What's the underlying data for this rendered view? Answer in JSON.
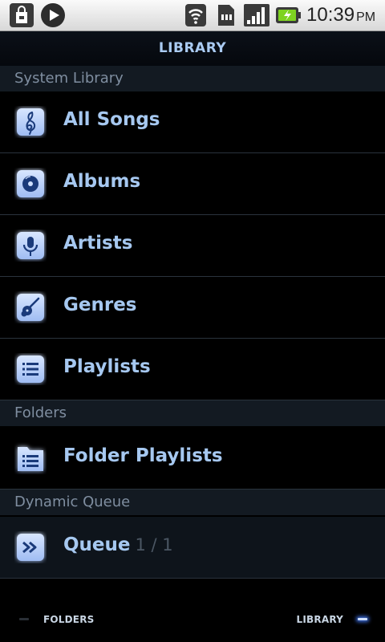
{
  "status_bar": {
    "time": "10:39",
    "ampm": "PM",
    "icons": [
      "shopping-bag-notification-icon",
      "play-notification-icon",
      "wifi-icon",
      "sd-card-icon",
      "cell-signal-icon",
      "battery-charging-icon"
    ]
  },
  "title": "LIBRARY",
  "sections": {
    "system_library": {
      "header": "System Library",
      "items": [
        {
          "label": "All Songs",
          "icon": "treble-clef-icon"
        },
        {
          "label": "Albums",
          "icon": "disc-icon"
        },
        {
          "label": "Artists",
          "icon": "microphone-icon"
        },
        {
          "label": "Genres",
          "icon": "guitar-icon"
        },
        {
          "label": "Playlists",
          "icon": "list-icon"
        }
      ]
    },
    "folders": {
      "header": "Folders",
      "items": [
        {
          "label": "Folder Playlists",
          "icon": "folder-list-icon"
        }
      ]
    },
    "dynamic_queue": {
      "header": "Dynamic Queue",
      "items": [
        {
          "label": "Queue",
          "count": "1 / 1",
          "icon": "fast-forward-icon"
        }
      ]
    }
  },
  "bottom_bar": {
    "left_tab": "FOLDERS",
    "right_tab": "LIBRARY",
    "active_tab": "LIBRARY"
  },
  "colors": {
    "accent": "#a6c8f0",
    "icon_glow": "#3d6fe0",
    "section_header_bg": "#131a22",
    "section_header_text": "#7f8ea0"
  }
}
